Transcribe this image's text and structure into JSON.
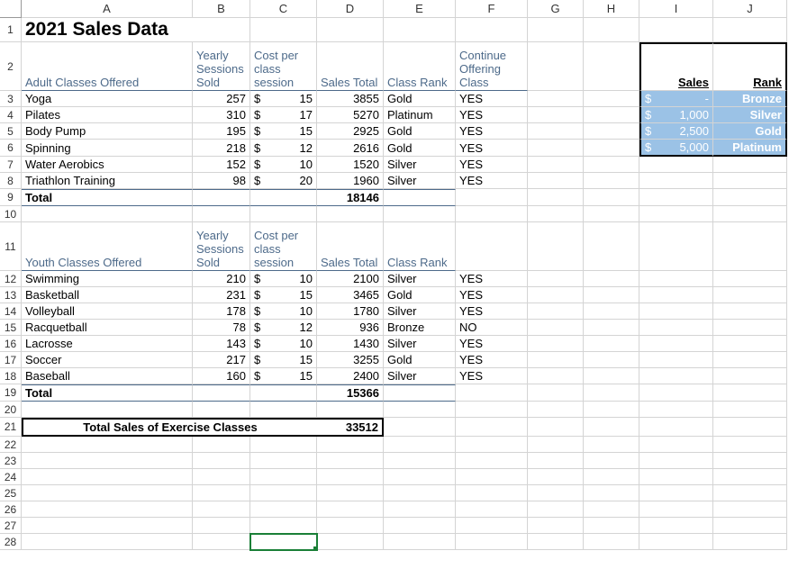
{
  "columns": [
    "A",
    "B",
    "C",
    "D",
    "E",
    "F",
    "G",
    "H",
    "I",
    "J"
  ],
  "row_count": 28,
  "title": "2021 Sales Data",
  "adult": {
    "header": {
      "a": "Adult Classes Offered",
      "b": "Yearly Sessions Sold",
      "c": "Cost per class session",
      "d": "Sales Total",
      "e": "Class Rank",
      "f": "Continue Offering Class"
    },
    "rows": [
      {
        "a": "Yoga",
        "b": "257",
        "c_sym": "$",
        "c": "15",
        "d": "3855",
        "e": "Gold",
        "f": "YES"
      },
      {
        "a": "Pilates",
        "b": "310",
        "c_sym": "$",
        "c": "17",
        "d": "5270",
        "e": "Platinum",
        "f": "YES"
      },
      {
        "a": "Body Pump",
        "b": "195",
        "c_sym": "$",
        "c": "15",
        "d": "2925",
        "e": "Gold",
        "f": "YES"
      },
      {
        "a": "Spinning",
        "b": "218",
        "c_sym": "$",
        "c": "12",
        "d": "2616",
        "e": "Gold",
        "f": "YES"
      },
      {
        "a": "Water Aerobics",
        "b": "152",
        "c_sym": "$",
        "c": "10",
        "d": "1520",
        "e": "Silver",
        "f": "YES"
      },
      {
        "a": "Triathlon Training",
        "b": "98",
        "c_sym": "$",
        "c": "20",
        "d": "1960",
        "e": "Silver",
        "f": "YES"
      }
    ],
    "total_label": "Total",
    "total_value": "18146"
  },
  "youth": {
    "header": {
      "a": "Youth Classes Offered",
      "b": "Yearly Sessions Sold",
      "c": "Cost per class session",
      "d": "Sales Total",
      "e": "Class Rank"
    },
    "rows": [
      {
        "a": "Swimming",
        "b": "210",
        "c_sym": "$",
        "c": "10",
        "d": "2100",
        "e": "Silver",
        "f": "YES"
      },
      {
        "a": "Basketball",
        "b": "231",
        "c_sym": "$",
        "c": "15",
        "d": "3465",
        "e": "Gold",
        "f": "YES"
      },
      {
        "a": "Volleyball",
        "b": "178",
        "c_sym": "$",
        "c": "10",
        "d": "1780",
        "e": "Silver",
        "f": "YES"
      },
      {
        "a": "Racquetball",
        "b": "78",
        "c_sym": "$",
        "c": "12",
        "d": "936",
        "e": "Bronze",
        "f": "NO"
      },
      {
        "a": "Lacrosse",
        "b": "143",
        "c_sym": "$",
        "c": "10",
        "d": "1430",
        "e": "Silver",
        "f": "YES"
      },
      {
        "a": "Soccer",
        "b": "217",
        "c_sym": "$",
        "c": "15",
        "d": "3255",
        "e": "Gold",
        "f": "YES"
      },
      {
        "a": "Baseball",
        "b": "160",
        "c_sym": "$",
        "c": "15",
        "d": "2400",
        "e": "Silver",
        "f": "YES"
      }
    ],
    "total_label": "Total",
    "total_value": "15366"
  },
  "grand_total": {
    "label": "Total Sales of Exercise Classes",
    "value": "33512"
  },
  "legend": {
    "headers": {
      "sales": "Sales",
      "rank": "Rank"
    },
    "rows": [
      {
        "sym": "$",
        "amount": "-",
        "rank": "Bronze"
      },
      {
        "sym": "$",
        "amount": "1,000",
        "rank": "Silver"
      },
      {
        "sym": "$",
        "amount": "2,500",
        "rank": "Gold"
      },
      {
        "sym": "$",
        "amount": "5,000",
        "rank": "Platinum"
      }
    ]
  },
  "chart_data": {
    "type": "table",
    "title": "2021 Sales Data",
    "tables": [
      {
        "name": "Adult Classes Offered",
        "columns": [
          "Class",
          "Yearly Sessions Sold",
          "Cost per class session",
          "Sales Total",
          "Class Rank",
          "Continue Offering Class"
        ],
        "rows": [
          [
            "Yoga",
            257,
            15,
            3855,
            "Gold",
            "YES"
          ],
          [
            "Pilates",
            310,
            17,
            5270,
            "Platinum",
            "YES"
          ],
          [
            "Body Pump",
            195,
            15,
            2925,
            "Gold",
            "YES"
          ],
          [
            "Spinning",
            218,
            12,
            2616,
            "Gold",
            "YES"
          ],
          [
            "Water Aerobics",
            152,
            10,
            1520,
            "Silver",
            "YES"
          ],
          [
            "Triathlon Training",
            98,
            20,
            1960,
            "Silver",
            "YES"
          ]
        ],
        "total_sales": 18146
      },
      {
        "name": "Youth Classes Offered",
        "columns": [
          "Class",
          "Yearly Sessions Sold",
          "Cost per class session",
          "Sales Total",
          "Class Rank",
          "Continue Offering Class"
        ],
        "rows": [
          [
            "Swimming",
            210,
            10,
            2100,
            "Silver",
            "YES"
          ],
          [
            "Basketball",
            231,
            15,
            3465,
            "Gold",
            "YES"
          ],
          [
            "Volleyball",
            178,
            10,
            1780,
            "Silver",
            "YES"
          ],
          [
            "Racquetball",
            78,
            12,
            936,
            "Bronze",
            "NO"
          ],
          [
            "Lacrosse",
            143,
            10,
            1430,
            "Silver",
            "YES"
          ],
          [
            "Soccer",
            217,
            15,
            3255,
            "Gold",
            "YES"
          ],
          [
            "Baseball",
            160,
            15,
            2400,
            "Silver",
            "YES"
          ]
        ],
        "total_sales": 15366
      }
    ],
    "grand_total_sales": 33512,
    "rank_thresholds": [
      {
        "min_sales": 0,
        "rank": "Bronze"
      },
      {
        "min_sales": 1000,
        "rank": "Silver"
      },
      {
        "min_sales": 2500,
        "rank": "Gold"
      },
      {
        "min_sales": 5000,
        "rank": "Platinum"
      }
    ]
  }
}
